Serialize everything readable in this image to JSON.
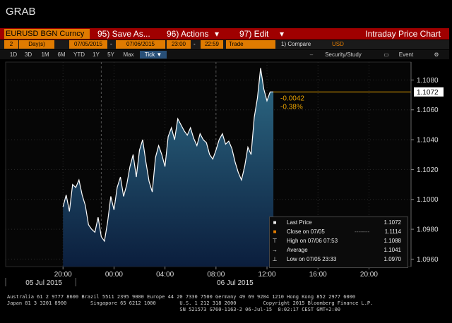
{
  "window_title": "GRAB",
  "title_bar": {
    "ticker": "EURUSD BGN Curncy",
    "save_as": "95) Save As...",
    "actions": "96) Actions",
    "edit": "97) Edit",
    "chart_name": "Intraday Price Chart",
    "chevron": "▾"
  },
  "controls": {
    "days": "2",
    "days_unit": "Day(s)",
    "start_date": "07/05/2015",
    "end_date": "07/06/2015",
    "start_time": "23:00",
    "end_time": "22:59",
    "separator": "-",
    "field": "Trade",
    "compare": "1) Compare",
    "currency": "USD"
  },
  "timeframes": [
    "1D",
    "3D",
    "1M",
    "6M",
    "YTD",
    "1Y",
    "5Y",
    "Max"
  ],
  "tick_label": "Tick ▼",
  "toolbar": {
    "security_study": "Security/Study",
    "event": "Event"
  },
  "chart_data": {
    "type": "area",
    "x_tick_labels": [
      "20:00",
      "00:00",
      "04:00",
      "08:00",
      "12:00",
      "16:00",
      "20:00"
    ],
    "x_date_labels": [
      "05 Jul 2015",
      "06 Jul 2015"
    ],
    "y_tick_labels": [
      "1.1080",
      "1.1060",
      "1.1040",
      "1.1020",
      "1.1000",
      "1.0980",
      "1.0960"
    ],
    "ylim": [
      1.0955,
      1.1092
    ],
    "last_price_tag": "1.1072",
    "change_abs": "-0.0042",
    "change_pct": "-0.38%",
    "series_hours": [
      0,
      0.25,
      0.5,
      0.75,
      1,
      1.25,
      1.5,
      1.75,
      2,
      2.25,
      2.5,
      2.75,
      3,
      3.25,
      3.5,
      3.75,
      4,
      4.25,
      4.5,
      4.75,
      5,
      5.25,
      5.5,
      5.75,
      6,
      6.25,
      6.5,
      6.75,
      7,
      7.25,
      7.5,
      7.75,
      8,
      8.25,
      8.5,
      8.75,
      9,
      9.25,
      9.5,
      9.75,
      10,
      10.25,
      10.5,
      10.75,
      11,
      11.25,
      11.5,
      11.75,
      12,
      12.25,
      12.5,
      12.75,
      13,
      13.25,
      13.5,
      13.75,
      14,
      14.25,
      14.5,
      14.75,
      15,
      15.25,
      15.5,
      15.75,
      16,
      16.25,
      16.5
    ],
    "series_values": [
      1.0995,
      1.1003,
      1.0992,
      1.101,
      1.1008,
      1.1013,
      1.1003,
      1.0996,
      1.0983,
      1.098,
      1.0978,
      1.0988,
      1.0975,
      1.0972,
      1.0985,
      1.1002,
      1.0993,
      1.1008,
      1.1015,
      1.1002,
      1.101,
      1.1022,
      1.103,
      1.1015,
      1.1033,
      1.104,
      1.1025,
      1.1012,
      1.1005,
      1.1028,
      1.1036,
      1.103,
      1.1022,
      1.1042,
      1.1048,
      1.104,
      1.1054,
      1.105,
      1.1046,
      1.1043,
      1.1048,
      1.1041,
      1.1036,
      1.1044,
      1.104,
      1.1038,
      1.103,
      1.1027,
      1.1033,
      1.104,
      1.1044,
      1.1037,
      1.1039,
      1.1034,
      1.1025,
      1.1018,
      1.1013,
      1.1022,
      1.1035,
      1.103,
      1.1055,
      1.1068,
      1.1088,
      1.1074,
      1.1066,
      1.1072,
      1.1072
    ],
    "x_axis_hour_labels_at": [
      0,
      4,
      8,
      12,
      16,
      20,
      24
    ],
    "legend": [
      {
        "key": "last",
        "name": "Last Price",
        "value": "1.1072",
        "dashes": ""
      },
      {
        "key": "close",
        "name": "Close on 07/05",
        "value": "1.1114",
        "dashes": "--------"
      },
      {
        "key": "high",
        "name": "High on 07/06 07:53",
        "value": "1.1088",
        "dashes": ""
      },
      {
        "key": "avg",
        "name": "Average",
        "value": "1.1041",
        "dashes": ""
      },
      {
        "key": "low",
        "name": "Low on 07/05 23:33",
        "value": "1.0970",
        "dashes": ""
      }
    ],
    "colors": {
      "area_top": "#2e6b86",
      "area_bottom": "#0b1e3d",
      "price_line": "#ffffff",
      "last_price_line": "#e8a200",
      "change_text": "#e8a200",
      "grid": "#2b2b2b"
    }
  },
  "footer_lines": [
    "Australia 61 2 9777 8600 Brazil 5511 2395 9000 Europe 44 20 7330 7500 Germany 49 69 9204 1210 Hong Kong 852 2977 6000",
    "Japan 81 3 3201 8900        Singapore 65 6212 1000        U.S. 1 212 318 2000         Copyright 2015 Bloomberg Finance L.P.",
    "                                                          SN 521573 G760-1163-2 06-Jul-15  8:02:17 CEST GMT+2:00"
  ]
}
